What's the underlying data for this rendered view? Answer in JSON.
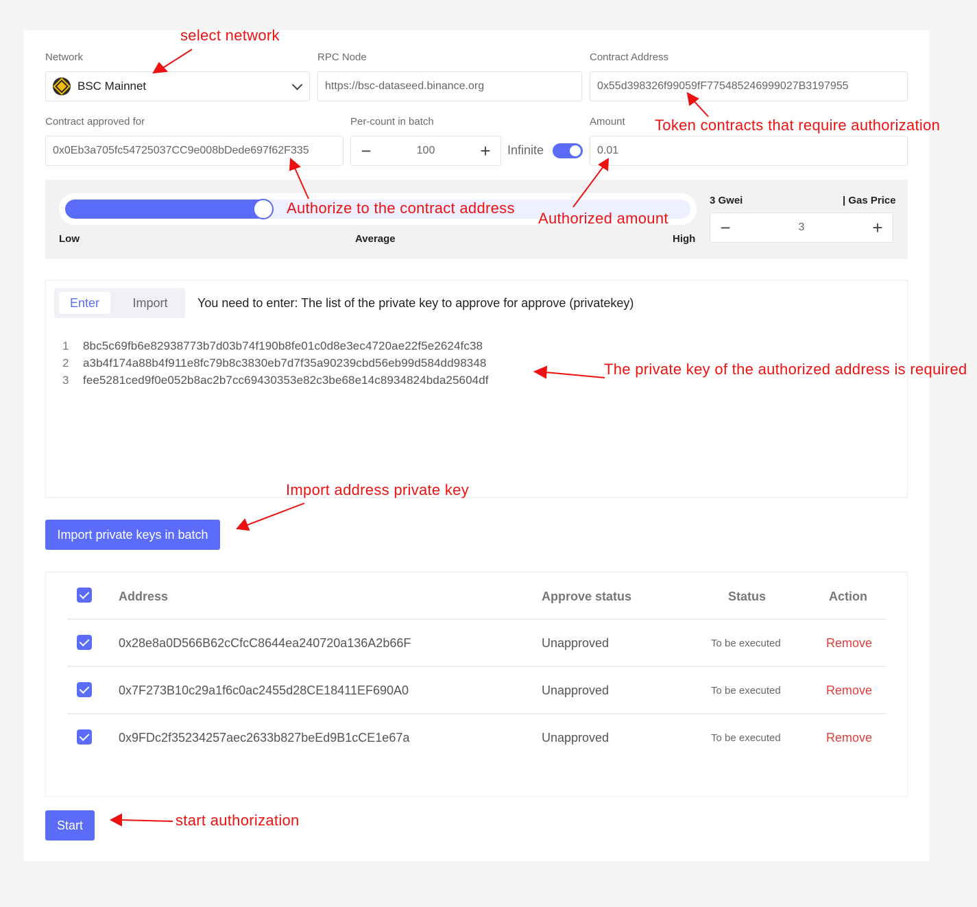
{
  "network": {
    "label": "Network",
    "selected": "BSC Mainnet",
    "icon": "bnb-icon"
  },
  "rpc": {
    "label": "RPC Node",
    "value": "https://bsc-dataseed.binance.org"
  },
  "contract": {
    "label": "Contract Address",
    "value": "0x55d398326f99059fF775485246999027B3197955"
  },
  "approved_for": {
    "label": "Contract approved for",
    "value": "0x0Eb3a705fc54725037CC9e008bDede697f62F335"
  },
  "batch": {
    "label": "Per-count in batch",
    "value": "100",
    "minus": "−",
    "plus": "+"
  },
  "infinite": {
    "label": "Infinite",
    "on": true
  },
  "amount": {
    "label": "Amount",
    "value": "0.01"
  },
  "gas": {
    "level_fraction": 0.33,
    "low": "Low",
    "average": "Average",
    "high": "High",
    "current": "3 Gwei",
    "price_label": "| Gas Price",
    "value": "3",
    "minus": "−",
    "plus": "+"
  },
  "keys": {
    "tab_enter": "Enter",
    "tab_import": "Import",
    "hint": "You need to enter: The list of the private key to approve for approve (privatekey)",
    "lines": [
      {
        "n": "1",
        "key": "8bc5c69fb6e82938773b7d03b74f190b8fe01c0d8e3ec4720ae22f5e2624fc38"
      },
      {
        "n": "2",
        "key": "a3b4f174a88b4f911e8fc79b8c3830eb7d7f35a90239cbd56eb99d584dd98348"
      },
      {
        "n": "3",
        "key": "fee5281ced9f0e052b8ac2b7cc69430353e82c3be68e14c8934824bda25604df"
      }
    ]
  },
  "import_button": "Import private keys in batch",
  "table": {
    "headers": {
      "address": "Address",
      "approve_status": "Approve status",
      "status": "Status",
      "action": "Action"
    },
    "rows": [
      {
        "address": "0x28e8a0D566B62cCfcC8644ea240720a136A2b66F",
        "approve_status": "Unapproved",
        "status": "To be executed",
        "action": "Remove"
      },
      {
        "address": "0x7F273B10c29a1f6c0ac2455d28CE18411EF690A0",
        "approve_status": "Unapproved",
        "status": "To be executed",
        "action": "Remove"
      },
      {
        "address": "0x9FDc2f35234257aec2633b827beEd9B1cCE1e67a",
        "approve_status": "Unapproved",
        "status": "To be executed",
        "action": "Remove"
      }
    ]
  },
  "start_button": "Start",
  "annotations": {
    "select_network": "select network",
    "token_contracts": "Token contracts that require authorization",
    "authorize_contract": "Authorize to the contract address",
    "authorized_amount": "Authorized amount",
    "private_key_required": "The private key of the authorized address is required",
    "import_key": "Import address private key",
    "start_auth": "start authorization"
  },
  "colors": {
    "accent": "#5b6cf9",
    "annotation": "#ee1111",
    "remove": "#e23b3b"
  }
}
